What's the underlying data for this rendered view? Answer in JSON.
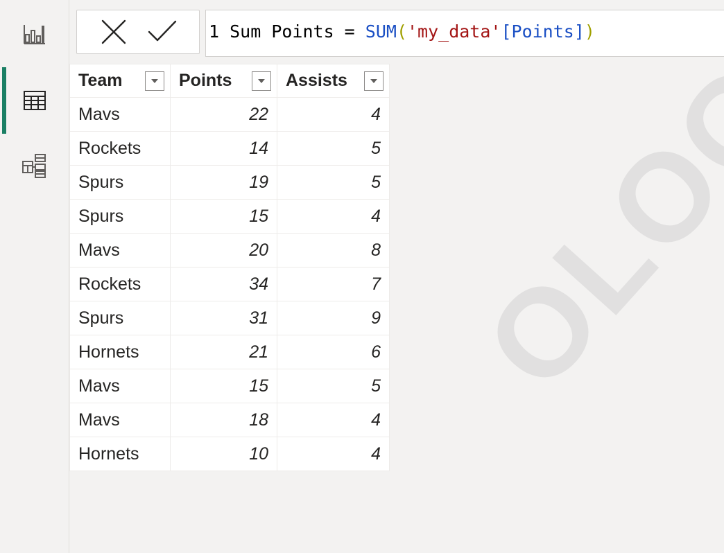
{
  "colors": {
    "accent": "#1a7f64",
    "function": "#1a4fc4",
    "string": "#a31515"
  },
  "sidebar": {
    "items": [
      {
        "name": "report-view",
        "icon": "bar-chart-icon",
        "active": false
      },
      {
        "name": "data-view",
        "icon": "table-icon",
        "active": true
      },
      {
        "name": "model-view",
        "icon": "model-icon",
        "active": false
      }
    ]
  },
  "formula": {
    "line_number": "1",
    "prefix": " Sum Points = ",
    "func": "SUM",
    "open": "(",
    "table": "'my_data'",
    "column": "[Points]",
    "close": ")",
    "cancel_icon": "close-icon",
    "commit_icon": "check-icon"
  },
  "table": {
    "headers": [
      "Team",
      "Points",
      "Assists"
    ],
    "rows": [
      [
        "Mavs",
        "22",
        "4"
      ],
      [
        "Rockets",
        "14",
        "5"
      ],
      [
        "Spurs",
        "19",
        "5"
      ],
      [
        "Spurs",
        "15",
        "4"
      ],
      [
        "Mavs",
        "20",
        "8"
      ],
      [
        "Rockets",
        "34",
        "7"
      ],
      [
        "Spurs",
        "31",
        "9"
      ],
      [
        "Hornets",
        "21",
        "6"
      ],
      [
        "Mavs",
        "15",
        "5"
      ],
      [
        "Mavs",
        "18",
        "4"
      ],
      [
        "Hornets",
        "10",
        "4"
      ]
    ]
  },
  "watermark": "OLOGY.CO"
}
